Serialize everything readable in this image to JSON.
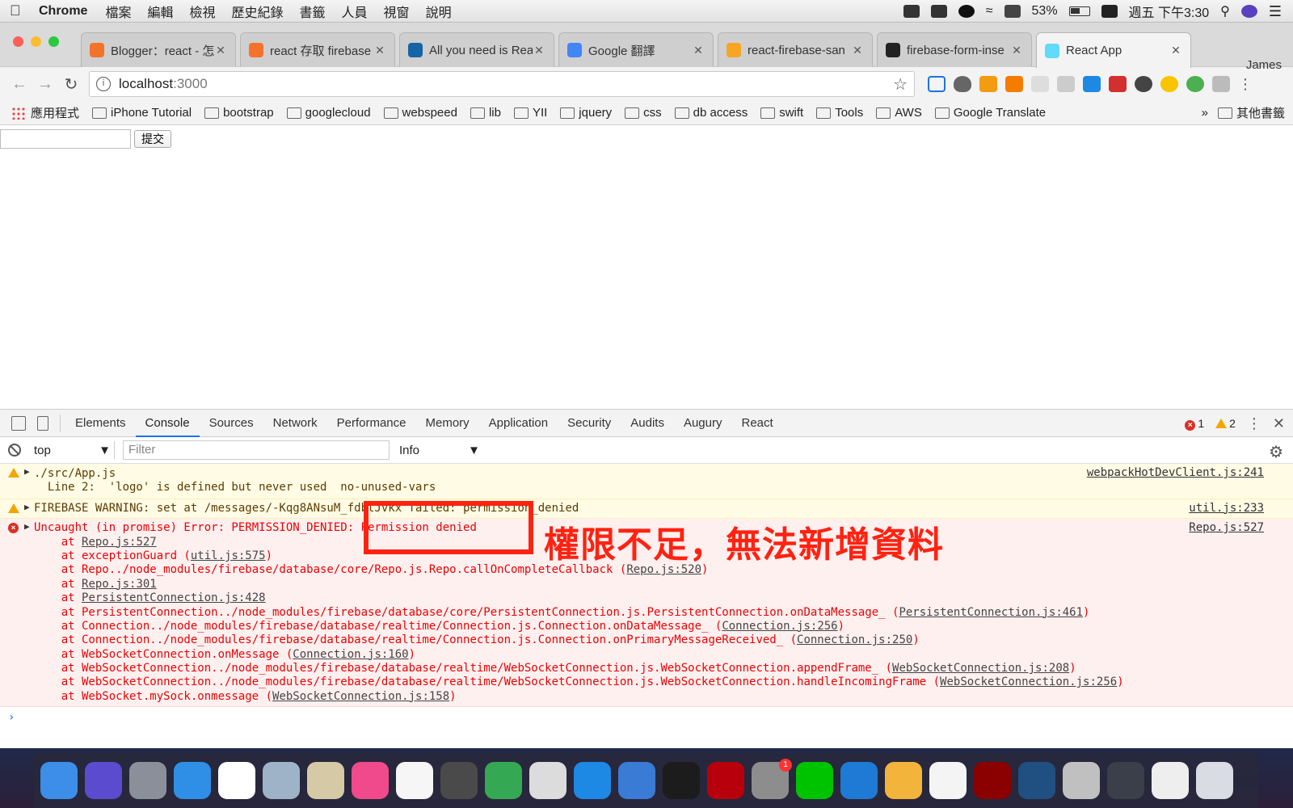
{
  "menubar": {
    "app": "Chrome",
    "items": [
      "檔案",
      "編輯",
      "檢視",
      "歷史紀錄",
      "書籤",
      "人員",
      "視窗",
      "說明"
    ],
    "battery": "53%",
    "datetime": "週五 下午3:30"
  },
  "tabs": [
    {
      "label": "Blogger：react - 怎",
      "fav_color": "#f4732b"
    },
    {
      "label": "react 存取 firebase",
      "fav_color": "#f4732b"
    },
    {
      "label": "All you need is Rea",
      "fav_color": "#1565a6"
    },
    {
      "label": "Google 翻譯",
      "fav_color": "#4285f4"
    },
    {
      "label": "react-firebase-san",
      "fav_color": "#f6a623"
    },
    {
      "label": "firebase-form-inse",
      "fav_color": "#222222"
    },
    {
      "label": "React App",
      "fav_color": "#61dafb"
    }
  ],
  "profile": "James",
  "omnibox": {
    "host": "localhost",
    "port": ":3000"
  },
  "bookmarks": {
    "apps": "應用程式",
    "items": [
      "iPhone Tutorial",
      "bootstrap",
      "googlecloud",
      "webspeed",
      "lib",
      "YII",
      "jquery",
      "css",
      "db access",
      "swift",
      "Tools",
      "AWS",
      "Google Translate"
    ],
    "more": "»",
    "other": "其他書籤"
  },
  "page": {
    "submit_label": "提交"
  },
  "devtools": {
    "tabs": [
      "Elements",
      "Console",
      "Sources",
      "Network",
      "Performance",
      "Memory",
      "Application",
      "Security",
      "Audits",
      "Augury",
      "React"
    ],
    "active_tab": "Console",
    "error_count": "1",
    "warning_count": "2",
    "context": "top",
    "filter_placeholder": "Filter",
    "level": "Info"
  },
  "console": {
    "warn1": {
      "lines": [
        "./src/App.js",
        "  Line 2:  'logo' is defined but never used  no-unused-vars"
      ],
      "source": "webpackHotDevClient.js:241"
    },
    "warn2": {
      "line": "FIREBASE WARNING: set at /messages/-Kqg8ANsuM_fdbtJvkx failed: permission_denied",
      "source": "util.js:233"
    },
    "error": {
      "line": "Uncaught (in promise) Error: PERMISSION_DENIED: Permission denied",
      "source": "Repo.js:527",
      "stack": [
        [
          "    at ",
          "Repo.js:527",
          ""
        ],
        [
          "    at exceptionGuard (",
          "util.js:575",
          ")"
        ],
        [
          "    at Repo../node_modules/firebase/database/core/Repo.js.Repo.callOnCompleteCallback (",
          "Repo.js:520",
          ")"
        ],
        [
          "    at ",
          "Repo.js:301",
          ""
        ],
        [
          "    at ",
          "PersistentConnection.js:428",
          ""
        ],
        [
          "    at PersistentConnection../node_modules/firebase/database/core/PersistentConnection.js.PersistentConnection.onDataMessage_ (",
          "PersistentConnection.js:461",
          ")"
        ],
        [
          "    at Connection../node_modules/firebase/database/realtime/Connection.js.Connection.onDataMessage_ (",
          "Connection.js:256",
          ")"
        ],
        [
          "    at Connection../node_modules/firebase/database/realtime/Connection.js.Connection.onPrimaryMessageReceived_ (",
          "Connection.js:250",
          ")"
        ],
        [
          "    at WebSocketConnection.onMessage (",
          "Connection.js:160",
          ")"
        ],
        [
          "    at WebSocketConnection../node_modules/firebase/database/realtime/WebSocketConnection.js.WebSocketConnection.appendFrame_ (",
          "WebSocketConnection.js:208",
          ")"
        ],
        [
          "    at WebSocketConnection../node_modules/firebase/database/realtime/WebSocketConnection.js.WebSocketConnection.handleIncomingFrame (",
          "WebSocketConnection.js:256",
          ")"
        ],
        [
          "    at WebSocket.mySock.onmessage (",
          "WebSocketConnection.js:158",
          ")"
        ]
      ]
    },
    "prompt": "›"
  },
  "annotation": "權限不足，無法新增資料",
  "dock": {
    "apps": [
      {
        "name": "finder-icon",
        "color": "#3d8ee8"
      },
      {
        "name": "siri-icon",
        "color": "#5b4bcf"
      },
      {
        "name": "launchpad-icon",
        "color": "#8a8f99"
      },
      {
        "name": "safari-icon",
        "color": "#2f8fe6"
      },
      {
        "name": "launchpad-grid-icon",
        "color": "#ffffff"
      },
      {
        "name": "mail-icon",
        "color": "#9fb3c8"
      },
      {
        "name": "preview-icon",
        "color": "#d6c9a6"
      },
      {
        "name": "itunes-icon",
        "color": "#f04a8c"
      },
      {
        "name": "photos-icon",
        "color": "#f6f6f6"
      },
      {
        "name": "sublime-icon",
        "color": "#4a4a4a"
      },
      {
        "name": "chrome-icon",
        "color": "#34a853"
      },
      {
        "name": "sequel-pro-icon",
        "color": "#dcdcdc"
      },
      {
        "name": "app-store-icon",
        "color": "#1e88e5"
      },
      {
        "name": "xcode-icon",
        "color": "#3a7bd5"
      },
      {
        "name": "terminal-icon",
        "color": "#1c1c1c"
      },
      {
        "name": "filezilla-icon",
        "color": "#b8000c"
      },
      {
        "name": "system-preferences-icon",
        "color": "#8d8d8d"
      },
      {
        "name": "line-icon",
        "color": "#00c300"
      },
      {
        "name": "vscode-icon",
        "color": "#1f7ad6"
      },
      {
        "name": "chrome-canary-icon",
        "color": "#f3b43b"
      },
      {
        "name": "textedit-icon",
        "color": "#f4f4f4"
      },
      {
        "name": "acrobat-icon",
        "color": "#8b0000"
      },
      {
        "name": "sourcetree-icon",
        "color": "#205081"
      },
      {
        "name": "scissors-icon",
        "color": "#c0c0c0"
      },
      {
        "name": "nox-icon",
        "color": "#3a3f4a"
      },
      {
        "name": "document-icon",
        "color": "#eeeeee"
      },
      {
        "name": "trash-icon",
        "color": "#d9dde3"
      }
    ],
    "badge": "1"
  }
}
